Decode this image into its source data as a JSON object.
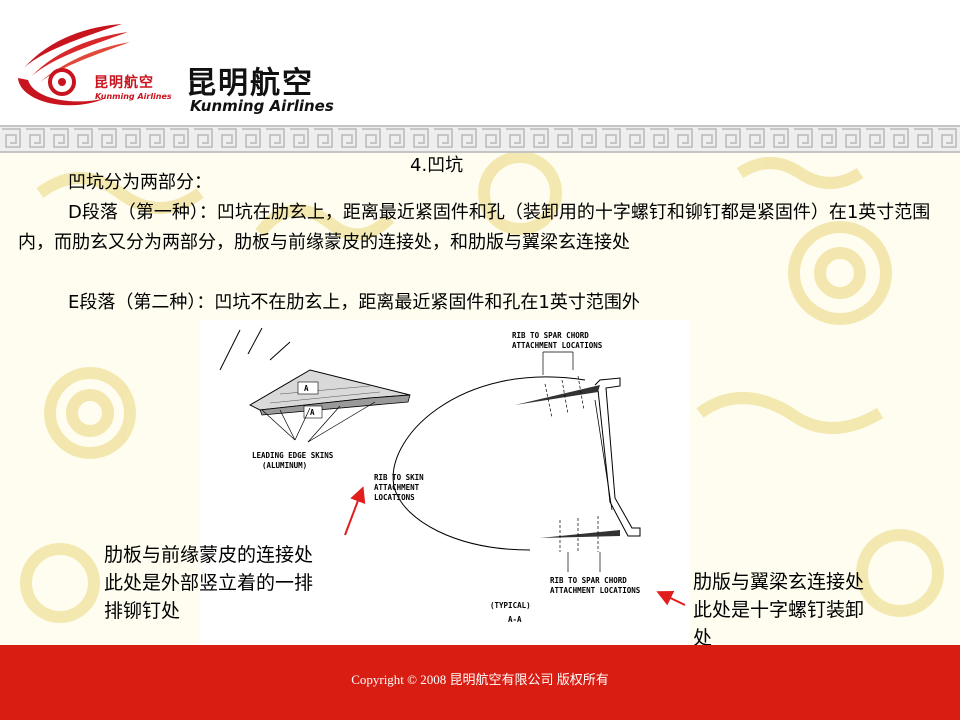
{
  "brand": {
    "logo_small_cn": "昆明航空",
    "logo_small_en": "Kunming Airlines",
    "logo_big_cn": "昆明航空",
    "logo_big_en": "Kunming Airlines",
    "brand_red": "#c8141e"
  },
  "slide": {
    "title": "4.凹坑",
    "intro": "凹坑分为两部分：",
    "part_d": "D段落（第一种）：凹坑在肋玄上，距离最近紧固件和孔（装卸用的十字螺钉和铆钉都是紧固件）在1英寸范围内，而肋玄又分为两部分，肋板与前缘蒙皮的连接处，和肋版与翼梁玄连接处",
    "part_e": "E段落（第二种）：凹坑不在肋玄上，距离最近紧固件和孔在1英寸范围外"
  },
  "diagram": {
    "leading_edge_label_1": "LEADING EDGE SKINS",
    "leading_edge_label_2": "(ALUMINUM)",
    "rib_skin_label_1": "RIB TO SKIN",
    "rib_skin_label_2": "ATTACHMENT",
    "rib_skin_label_3": "LOCATIONS",
    "spar_top_label_1": "RIB TO SPAR CHORD",
    "spar_top_label_2": "ATTACHMENT LOCATIONS",
    "spar_bottom_label_1": "RIB TO SPAR CHORD",
    "spar_bottom_label_2": "ATTACHMENT LOCATIONS",
    "typical_label": "(TYPICAL)",
    "section_label": "A-A",
    "marker_a": "A"
  },
  "notes": {
    "left_1": "肋板与前缘蒙皮的连接处",
    "left_2": "此处是外部竖立着的一排",
    "left_3": "排铆钉处",
    "right_1": "肋版与翼梁玄连接处",
    "right_2": "此处是十字螺钉装卸",
    "right_3": "处"
  },
  "footer": {
    "copyright": "Copyright © 2008 昆明航空有限公司 版权所有"
  }
}
